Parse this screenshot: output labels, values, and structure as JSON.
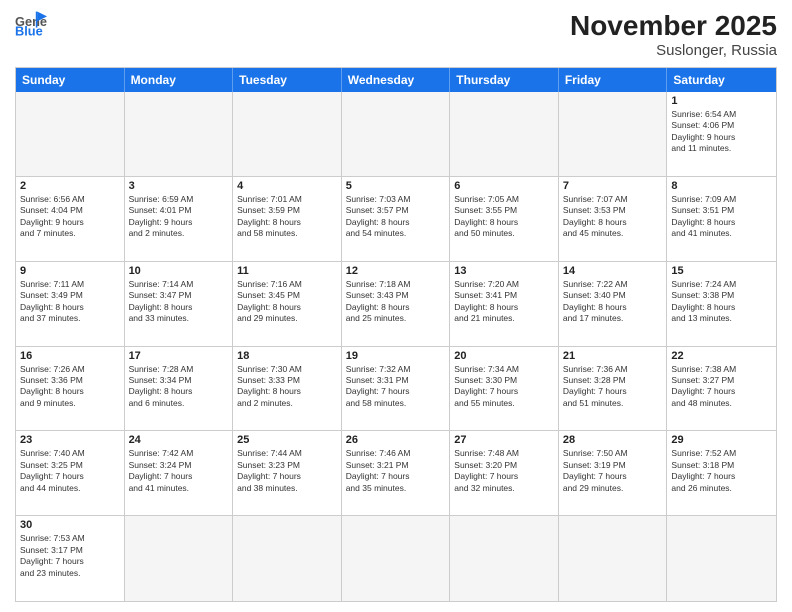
{
  "header": {
    "logo_line1": "General",
    "logo_line2": "Blue",
    "title": "November 2025",
    "subtitle": "Suslonger, Russia"
  },
  "days_of_week": [
    "Sunday",
    "Monday",
    "Tuesday",
    "Wednesday",
    "Thursday",
    "Friday",
    "Saturday"
  ],
  "weeks": [
    [
      {
        "day": "",
        "info": ""
      },
      {
        "day": "",
        "info": ""
      },
      {
        "day": "",
        "info": ""
      },
      {
        "day": "",
        "info": ""
      },
      {
        "day": "",
        "info": ""
      },
      {
        "day": "",
        "info": ""
      },
      {
        "day": "1",
        "info": "Sunrise: 6:54 AM\nSunset: 4:06 PM\nDaylight: 9 hours\nand 11 minutes."
      }
    ],
    [
      {
        "day": "2",
        "info": "Sunrise: 6:56 AM\nSunset: 4:04 PM\nDaylight: 9 hours\nand 7 minutes."
      },
      {
        "day": "3",
        "info": "Sunrise: 6:59 AM\nSunset: 4:01 PM\nDaylight: 9 hours\nand 2 minutes."
      },
      {
        "day": "4",
        "info": "Sunrise: 7:01 AM\nSunset: 3:59 PM\nDaylight: 8 hours\nand 58 minutes."
      },
      {
        "day": "5",
        "info": "Sunrise: 7:03 AM\nSunset: 3:57 PM\nDaylight: 8 hours\nand 54 minutes."
      },
      {
        "day": "6",
        "info": "Sunrise: 7:05 AM\nSunset: 3:55 PM\nDaylight: 8 hours\nand 50 minutes."
      },
      {
        "day": "7",
        "info": "Sunrise: 7:07 AM\nSunset: 3:53 PM\nDaylight: 8 hours\nand 45 minutes."
      },
      {
        "day": "8",
        "info": "Sunrise: 7:09 AM\nSunset: 3:51 PM\nDaylight: 8 hours\nand 41 minutes."
      }
    ],
    [
      {
        "day": "9",
        "info": "Sunrise: 7:11 AM\nSunset: 3:49 PM\nDaylight: 8 hours\nand 37 minutes."
      },
      {
        "day": "10",
        "info": "Sunrise: 7:14 AM\nSunset: 3:47 PM\nDaylight: 8 hours\nand 33 minutes."
      },
      {
        "day": "11",
        "info": "Sunrise: 7:16 AM\nSunset: 3:45 PM\nDaylight: 8 hours\nand 29 minutes."
      },
      {
        "day": "12",
        "info": "Sunrise: 7:18 AM\nSunset: 3:43 PM\nDaylight: 8 hours\nand 25 minutes."
      },
      {
        "day": "13",
        "info": "Sunrise: 7:20 AM\nSunset: 3:41 PM\nDaylight: 8 hours\nand 21 minutes."
      },
      {
        "day": "14",
        "info": "Sunrise: 7:22 AM\nSunset: 3:40 PM\nDaylight: 8 hours\nand 17 minutes."
      },
      {
        "day": "15",
        "info": "Sunrise: 7:24 AM\nSunset: 3:38 PM\nDaylight: 8 hours\nand 13 minutes."
      }
    ],
    [
      {
        "day": "16",
        "info": "Sunrise: 7:26 AM\nSunset: 3:36 PM\nDaylight: 8 hours\nand 9 minutes."
      },
      {
        "day": "17",
        "info": "Sunrise: 7:28 AM\nSunset: 3:34 PM\nDaylight: 8 hours\nand 6 minutes."
      },
      {
        "day": "18",
        "info": "Sunrise: 7:30 AM\nSunset: 3:33 PM\nDaylight: 8 hours\nand 2 minutes."
      },
      {
        "day": "19",
        "info": "Sunrise: 7:32 AM\nSunset: 3:31 PM\nDaylight: 7 hours\nand 58 minutes."
      },
      {
        "day": "20",
        "info": "Sunrise: 7:34 AM\nSunset: 3:30 PM\nDaylight: 7 hours\nand 55 minutes."
      },
      {
        "day": "21",
        "info": "Sunrise: 7:36 AM\nSunset: 3:28 PM\nDaylight: 7 hours\nand 51 minutes."
      },
      {
        "day": "22",
        "info": "Sunrise: 7:38 AM\nSunset: 3:27 PM\nDaylight: 7 hours\nand 48 minutes."
      }
    ],
    [
      {
        "day": "23",
        "info": "Sunrise: 7:40 AM\nSunset: 3:25 PM\nDaylight: 7 hours\nand 44 minutes."
      },
      {
        "day": "24",
        "info": "Sunrise: 7:42 AM\nSunset: 3:24 PM\nDaylight: 7 hours\nand 41 minutes."
      },
      {
        "day": "25",
        "info": "Sunrise: 7:44 AM\nSunset: 3:23 PM\nDaylight: 7 hours\nand 38 minutes."
      },
      {
        "day": "26",
        "info": "Sunrise: 7:46 AM\nSunset: 3:21 PM\nDaylight: 7 hours\nand 35 minutes."
      },
      {
        "day": "27",
        "info": "Sunrise: 7:48 AM\nSunset: 3:20 PM\nDaylight: 7 hours\nand 32 minutes."
      },
      {
        "day": "28",
        "info": "Sunrise: 7:50 AM\nSunset: 3:19 PM\nDaylight: 7 hours\nand 29 minutes."
      },
      {
        "day": "29",
        "info": "Sunrise: 7:52 AM\nSunset: 3:18 PM\nDaylight: 7 hours\nand 26 minutes."
      }
    ],
    [
      {
        "day": "30",
        "info": "Sunrise: 7:53 AM\nSunset: 3:17 PM\nDaylight: 7 hours\nand 23 minutes."
      },
      {
        "day": "",
        "info": ""
      },
      {
        "day": "",
        "info": ""
      },
      {
        "day": "",
        "info": ""
      },
      {
        "day": "",
        "info": ""
      },
      {
        "day": "",
        "info": ""
      },
      {
        "day": "",
        "info": ""
      }
    ]
  ]
}
